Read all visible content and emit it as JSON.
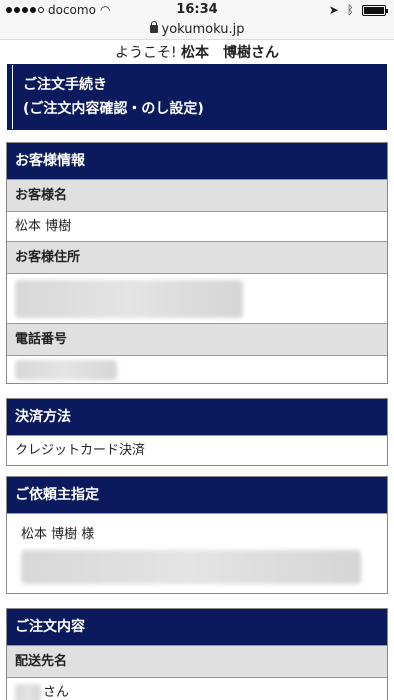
{
  "status_bar": {
    "carrier": "docomo",
    "time": "16:34"
  },
  "url_bar": {
    "domain": "yokumoku.jp"
  },
  "welcome": {
    "prefix": "ようこそ!",
    "name": "松本　博樹",
    "suffix": "さん"
  },
  "page_title": {
    "line1": "ご注文手続き",
    "line2": "(ご注文内容確認・のし設定)"
  },
  "customer_info": {
    "heading": "お客様情報",
    "name_label": "お客様名",
    "name_value": "松本 博樹",
    "address_label": "お客様住所",
    "phone_label": "電話番号"
  },
  "payment": {
    "heading": "決済方法",
    "value": "クレジットカード決済"
  },
  "requester": {
    "heading": "ご依頼主指定",
    "name": "松本 博樹 様"
  },
  "order": {
    "heading": "ご注文内容",
    "destination_label": "配送先名",
    "destination_suffix": "さん"
  }
}
